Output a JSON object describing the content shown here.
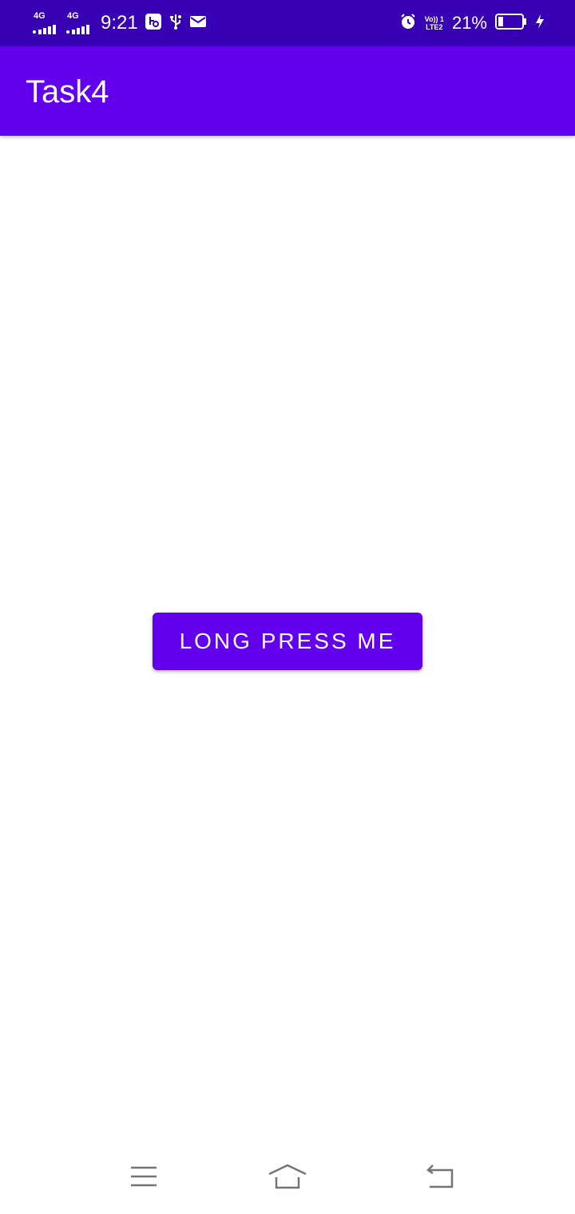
{
  "status_bar": {
    "network_1": "4G",
    "network_2": "4G",
    "time": "9:21",
    "volte_top": "Vo)) 1",
    "volte_bottom": "LTE2",
    "battery_percent": "21%",
    "battery_level": 0.21,
    "icons": [
      "signal-icon",
      "signal-icon",
      "app-notification-icon",
      "usb-icon",
      "mail-icon",
      "alarm-icon",
      "volte-icon",
      "battery-icon",
      "charging-icon"
    ]
  },
  "app_bar": {
    "title": "Task4"
  },
  "main": {
    "button_label": "LONG PRESS ME"
  },
  "nav_bar": {
    "icons": [
      "menu-icon",
      "home-icon",
      "back-icon"
    ]
  },
  "colors": {
    "status_bar": "#3700B3",
    "primary": "#6200EE",
    "background": "#FFFFFF",
    "nav_icon": "#757575"
  }
}
